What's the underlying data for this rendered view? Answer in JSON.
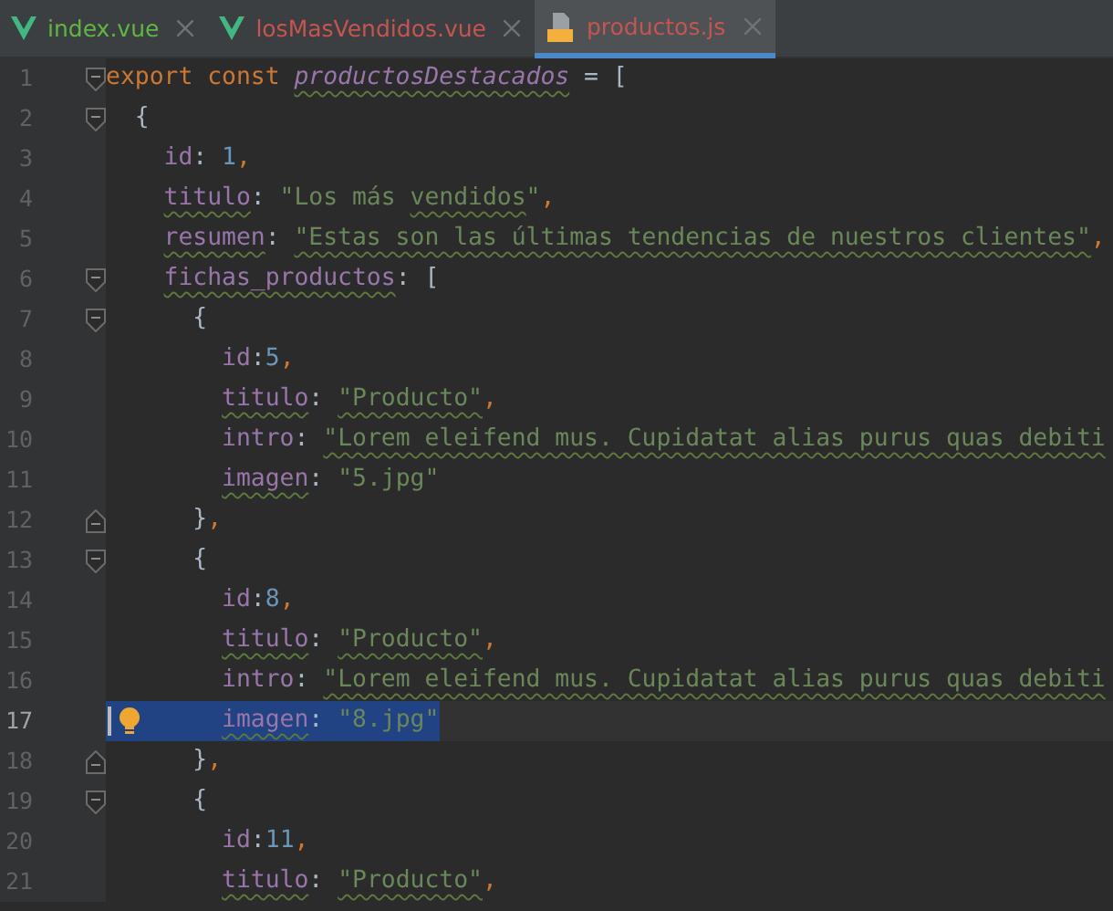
{
  "tabs": [
    {
      "label": "index.vue",
      "kind": "vue",
      "color": "#62b543",
      "selected": false
    },
    {
      "label": "losMasVendidos.vue",
      "kind": "vue",
      "color": "#c75450",
      "selected": false
    },
    {
      "label": "productos.js",
      "kind": "js",
      "color": "#c75450",
      "selected": true
    }
  ],
  "lines": [
    {
      "number": "1",
      "fold_start": true,
      "selected": false,
      "tokens": [
        {
          "kind": "keyword",
          "text": "export const "
        },
        {
          "kind": "constant",
          "text": "productosDestacados",
          "warning": true
        },
        {
          "kind": "punct",
          "text": " = ["
        }
      ]
    },
    {
      "number": "2",
      "fold_start": true,
      "selected": false,
      "tokens": [
        {
          "kind": "punct",
          "text": "  {"
        }
      ]
    },
    {
      "number": "3",
      "selected": false,
      "tokens": [
        {
          "kind": "prop",
          "text": "    id"
        },
        {
          "kind": "punct",
          "text": ": "
        },
        {
          "kind": "number",
          "text": "1"
        },
        {
          "kind": "keyword",
          "text": ","
        }
      ]
    },
    {
      "number": "4",
      "selected": false,
      "tokens": [
        {
          "kind": "prop",
          "text": "    titulo",
          "warning": true
        },
        {
          "kind": "punct",
          "text": ": "
        },
        {
          "kind": "string",
          "text": "\"Los más "
        },
        {
          "kind": "string",
          "text": "vendidos",
          "warning": true
        },
        {
          "kind": "string",
          "text": "\""
        },
        {
          "kind": "keyword",
          "text": ","
        }
      ]
    },
    {
      "number": "5",
      "selected": false,
      "tokens": [
        {
          "kind": "prop",
          "text": "    resumen",
          "warning": true
        },
        {
          "kind": "punct",
          "text": ": "
        },
        {
          "kind": "string",
          "text": "\"Estas son las últimas tendencias de nuestros clientes\"",
          "warning": true
        },
        {
          "kind": "keyword",
          "text": ","
        }
      ]
    },
    {
      "number": "6",
      "fold_start": true,
      "selected": false,
      "tokens": [
        {
          "kind": "prop",
          "text": "    fichas_productos",
          "warning": true
        },
        {
          "kind": "punct",
          "text": ": ["
        }
      ]
    },
    {
      "number": "7",
      "fold_start": true,
      "selected": false,
      "tokens": [
        {
          "kind": "punct",
          "text": "      {"
        }
      ]
    },
    {
      "number": "8",
      "selected": false,
      "tokens": [
        {
          "kind": "prop",
          "text": "        id"
        },
        {
          "kind": "punct",
          "text": ":"
        },
        {
          "kind": "number",
          "text": "5"
        },
        {
          "kind": "keyword",
          "text": ","
        }
      ]
    },
    {
      "number": "9",
      "selected": false,
      "tokens": [
        {
          "kind": "prop",
          "text": "        titulo",
          "warning": true
        },
        {
          "kind": "punct",
          "text": ": "
        },
        {
          "kind": "string",
          "text": "\"Producto\"",
          "warning": true
        },
        {
          "kind": "keyword",
          "text": ","
        }
      ]
    },
    {
      "number": "10",
      "selected": false,
      "tokens": [
        {
          "kind": "prop",
          "text": "        intro"
        },
        {
          "kind": "punct",
          "text": ": "
        },
        {
          "kind": "string",
          "text": "\"Lorem eleifend mus. Cupidatat alias purus quas debiti",
          "warning": true
        }
      ]
    },
    {
      "number": "11",
      "selected": false,
      "tokens": [
        {
          "kind": "prop",
          "text": "        imagen",
          "warning": true
        },
        {
          "kind": "punct",
          "text": ": "
        },
        {
          "kind": "string",
          "text": "\"5.jpg\""
        }
      ]
    },
    {
      "number": "12",
      "fold_end": true,
      "selected": false,
      "tokens": [
        {
          "kind": "punct",
          "text": "      }"
        },
        {
          "kind": "keyword",
          "text": ","
        }
      ]
    },
    {
      "number": "13",
      "fold_start": true,
      "selected": false,
      "tokens": [
        {
          "kind": "punct",
          "text": "      {"
        }
      ]
    },
    {
      "number": "14",
      "selected": false,
      "tokens": [
        {
          "kind": "prop",
          "text": "        id"
        },
        {
          "kind": "punct",
          "text": ":"
        },
        {
          "kind": "number",
          "text": "8"
        },
        {
          "kind": "keyword",
          "text": ","
        }
      ]
    },
    {
      "number": "15",
      "selected": false,
      "tokens": [
        {
          "kind": "prop",
          "text": "        titulo",
          "warning": true
        },
        {
          "kind": "punct",
          "text": ": "
        },
        {
          "kind": "string",
          "text": "\"Producto\"",
          "warning": true
        },
        {
          "kind": "keyword",
          "text": ","
        }
      ]
    },
    {
      "number": "16",
      "selected": false,
      "tokens": [
        {
          "kind": "prop",
          "text": "        intro"
        },
        {
          "kind": "punct",
          "text": ": "
        },
        {
          "kind": "string",
          "text": "\"Lorem eleifend mus. Cupidatat alias purus quas debiti",
          "warning": true
        }
      ]
    },
    {
      "number": "17",
      "caret": true,
      "bulb": true,
      "selected": true,
      "tokens": [
        {
          "kind": "prop",
          "text": "        imagen",
          "warning": true
        },
        {
          "kind": "punct",
          "text": ": "
        },
        {
          "kind": "string",
          "text": "\"8.jpg\""
        }
      ]
    },
    {
      "number": "18",
      "fold_end": true,
      "selected": false,
      "tokens": [
        {
          "kind": "punct",
          "text": "      }"
        },
        {
          "kind": "keyword",
          "text": ","
        }
      ]
    },
    {
      "number": "19",
      "fold_start": true,
      "selected": false,
      "tokens": [
        {
          "kind": "punct",
          "text": "      {"
        }
      ]
    },
    {
      "number": "20",
      "selected": false,
      "tokens": [
        {
          "kind": "prop",
          "text": "        id"
        },
        {
          "kind": "punct",
          "text": ":"
        },
        {
          "kind": "number",
          "text": "11"
        },
        {
          "kind": "keyword",
          "text": ","
        }
      ]
    },
    {
      "number": "21",
      "selected": false,
      "tokens": [
        {
          "kind": "prop",
          "text": "        titulo",
          "warning": true
        },
        {
          "kind": "punct",
          "text": ": "
        },
        {
          "kind": "string",
          "text": "\"Producto\"",
          "warning": true
        },
        {
          "kind": "keyword",
          "text": ","
        }
      ]
    }
  ]
}
